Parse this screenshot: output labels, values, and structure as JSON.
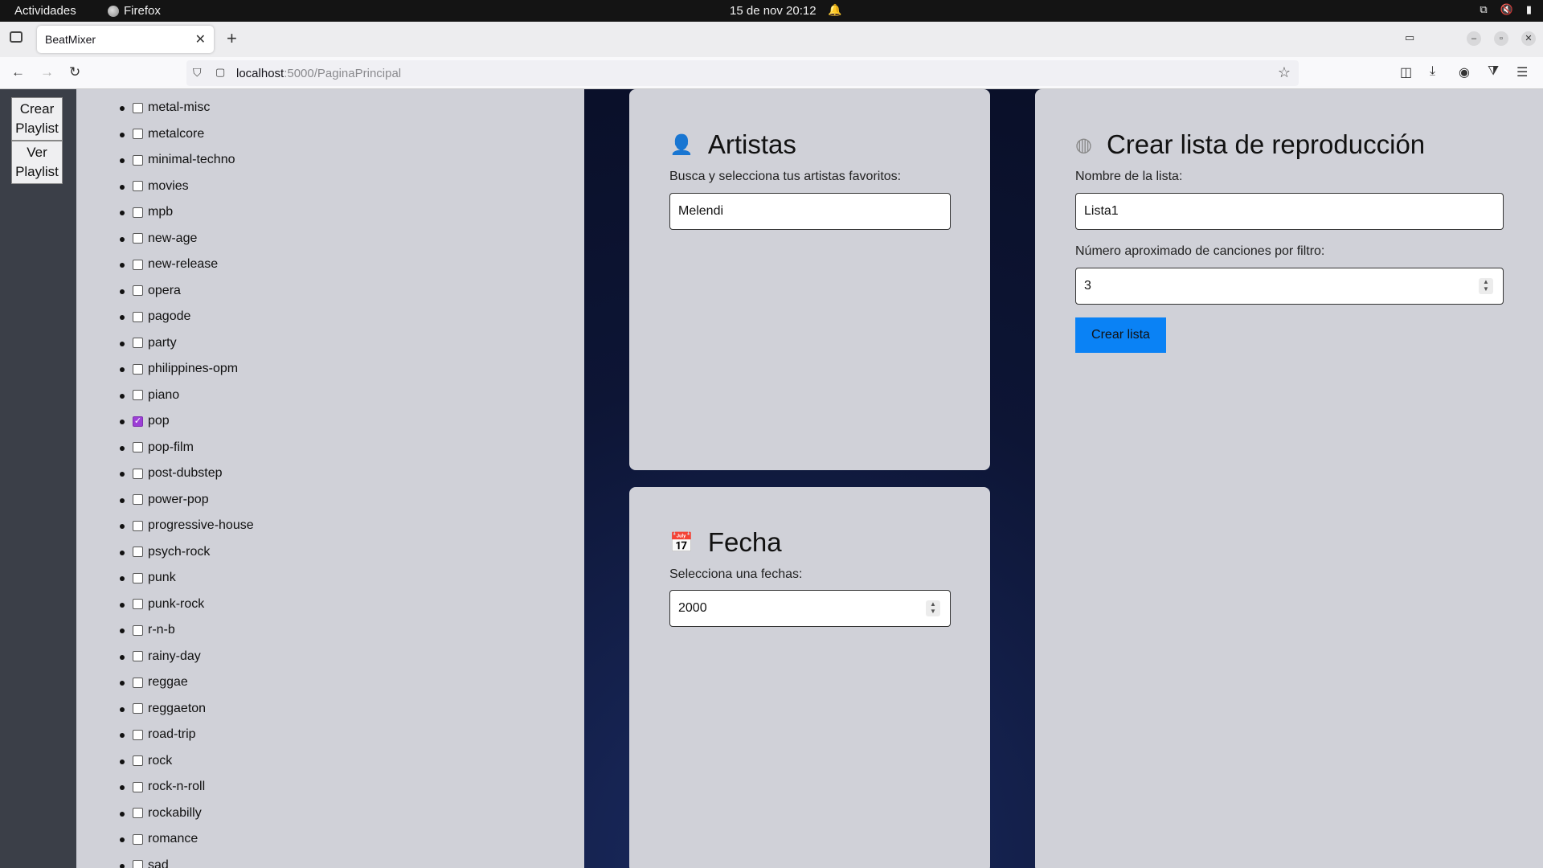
{
  "system": {
    "activities": "Actividades",
    "app_name": "Firefox",
    "clock": "15 de nov  20:12"
  },
  "browser": {
    "tab_title": "BeatMixer",
    "url_host": "localhost",
    "url_path": ":5000/PaginaPrincipal"
  },
  "sidebar": {
    "create_playlist": [
      "Crear",
      "Playlist"
    ],
    "view_playlist": [
      "Ver",
      "Playlist"
    ]
  },
  "genres": [
    {
      "name": "metal-misc",
      "checked": false
    },
    {
      "name": "metalcore",
      "checked": false
    },
    {
      "name": "minimal-techno",
      "checked": false
    },
    {
      "name": "movies",
      "checked": false
    },
    {
      "name": "mpb",
      "checked": false
    },
    {
      "name": "new-age",
      "checked": false
    },
    {
      "name": "new-release",
      "checked": false
    },
    {
      "name": "opera",
      "checked": false
    },
    {
      "name": "pagode",
      "checked": false
    },
    {
      "name": "party",
      "checked": false
    },
    {
      "name": "philippines-opm",
      "checked": false
    },
    {
      "name": "piano",
      "checked": false
    },
    {
      "name": "pop",
      "checked": true
    },
    {
      "name": "pop-film",
      "checked": false
    },
    {
      "name": "post-dubstep",
      "checked": false
    },
    {
      "name": "power-pop",
      "checked": false
    },
    {
      "name": "progressive-house",
      "checked": false
    },
    {
      "name": "psych-rock",
      "checked": false
    },
    {
      "name": "punk",
      "checked": false
    },
    {
      "name": "punk-rock",
      "checked": false
    },
    {
      "name": "r-n-b",
      "checked": false
    },
    {
      "name": "rainy-day",
      "checked": false
    },
    {
      "name": "reggae",
      "checked": false
    },
    {
      "name": "reggaeton",
      "checked": false
    },
    {
      "name": "road-trip",
      "checked": false
    },
    {
      "name": "rock",
      "checked": false
    },
    {
      "name": "rock-n-roll",
      "checked": false
    },
    {
      "name": "rockabilly",
      "checked": false
    },
    {
      "name": "romance",
      "checked": false
    },
    {
      "name": "sad",
      "checked": false
    }
  ],
  "artistas": {
    "icon": "user-icon",
    "title": "Artistas",
    "label": "Busca y selecciona tus artistas favoritos:",
    "value": "Melendi"
  },
  "fecha": {
    "icon": "calendar-icon",
    "title": "Fecha",
    "label": "Selecciona una fechas:",
    "value": "2000"
  },
  "crear": {
    "icon": "disc-icon",
    "title": "Crear lista de reproducción",
    "name_label": "Nombre de la lista:",
    "name_value": "Lista1",
    "count_label": "Número aproximado de canciones por filtro:",
    "count_value": "3",
    "button": "Crear lista",
    "button_color": "#0a82f5"
  }
}
